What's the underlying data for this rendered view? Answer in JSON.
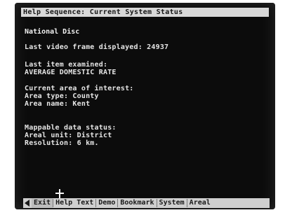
{
  "screen": {
    "title": "Help Sequence: Current System Status",
    "disc_name": "National Disc",
    "frame_line": "Last video frame displayed: 24937",
    "last_item_label": "Last item examined:",
    "last_item_value": "AVERAGE DOMESTIC RATE",
    "area_heading": "Current area of interest:",
    "area_type": "Area type: County",
    "area_name": "Area name: Kent",
    "mappable_heading": "Mappable data status:",
    "areal_unit": "Areal unit: District",
    "resolution": "Resolution: 6 km."
  },
  "menu": {
    "items": [
      "Exit",
      "Help Text",
      "Demo",
      "Bookmark",
      "System",
      "Areal"
    ]
  },
  "colors": {
    "screen_bg": "#0c0c0c",
    "text": "#e6e6e6",
    "bar_bg": "#d8d8d8"
  }
}
